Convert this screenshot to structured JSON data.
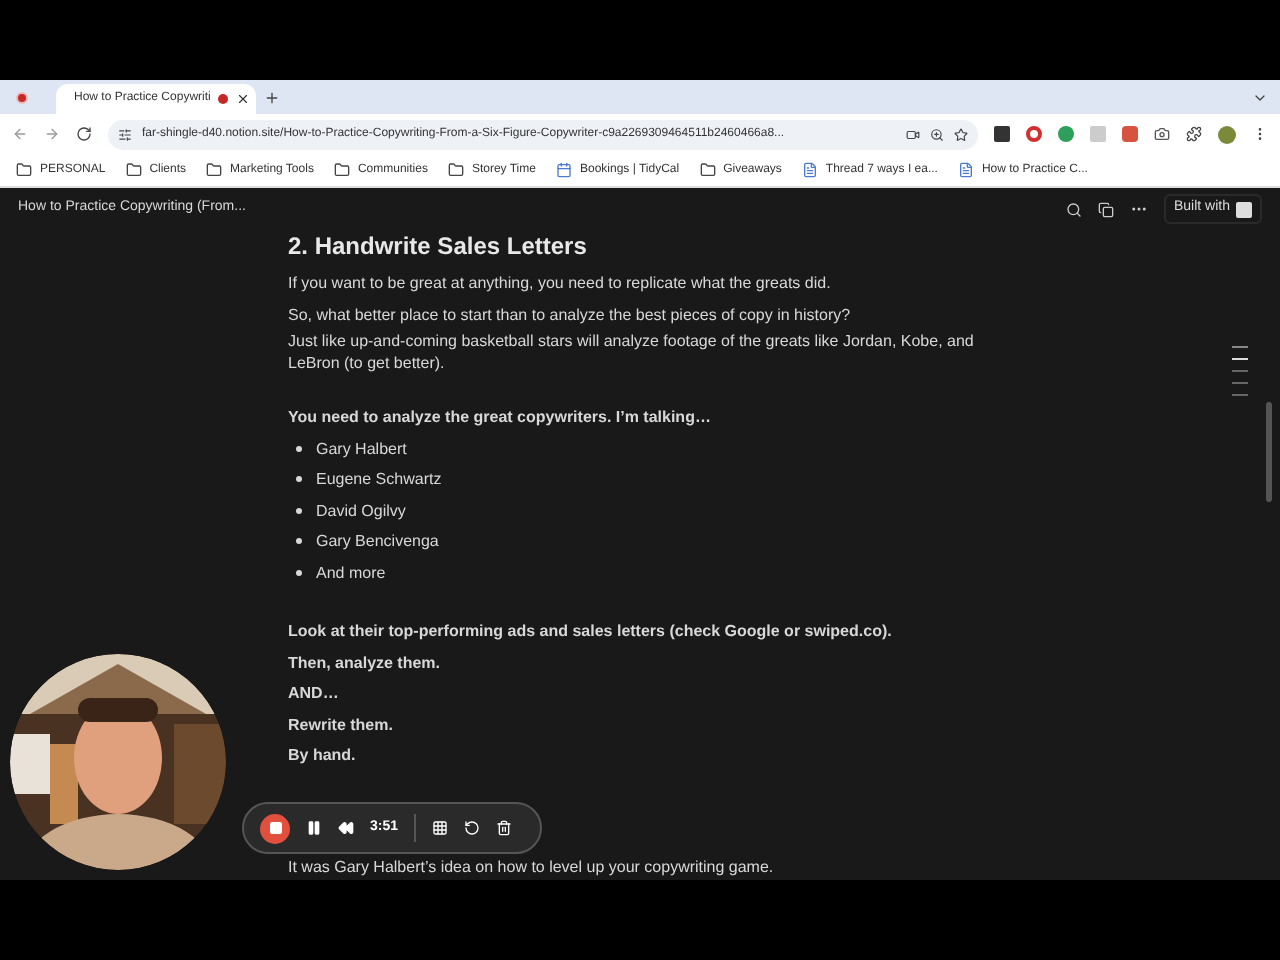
{
  "browser": {
    "tabs": [
      {
        "title": "How to Practice Copywriti",
        "selected": true,
        "recording": true
      }
    ],
    "url": "far-shingle-d40.notion.site/How-to-Practice-Copywriting-From-a-Six-Figure-Copywriter-c9a2269309464511b2460466a8...",
    "bookmarks": [
      {
        "kind": "folder",
        "label": "PERSONAL"
      },
      {
        "kind": "folder",
        "label": "Clients"
      },
      {
        "kind": "folder",
        "label": "Marketing Tools"
      },
      {
        "kind": "folder",
        "label": "Communities"
      },
      {
        "kind": "folder",
        "label": "Storey Time"
      },
      {
        "kind": "page",
        "label": "Bookings | TidyCal"
      },
      {
        "kind": "folder",
        "label": "Giveaways"
      },
      {
        "kind": "doc",
        "label": "Thread 7 ways I ea..."
      },
      {
        "kind": "doc",
        "label": "How to Practice C..."
      }
    ]
  },
  "page": {
    "title": "How to Practice Copywriting (From...",
    "built_with": "Built with",
    "sections": [
      {
        "blocks": [
          {
            "kind": "heading",
            "text": "2. Handwrite Sales Letters",
            "bold": true
          },
          {
            "kind": "text",
            "text": "If you want to be great at anything, you need to replicate what the greats did.",
            "bold": false
          },
          {
            "kind": "text",
            "text": "So, what better place to start than to analyze the best pieces of copy in history?",
            "bold": false
          },
          {
            "kind": "text",
            "text": "Just like up-and-coming basketball stars will analyze footage of the greats like Jordan, Kobe, and LeBron (to get better).",
            "bold": false
          }
        ]
      },
      {
        "blocks": [
          {
            "kind": "text",
            "text": "You need to analyze the great copywriters. I’m talking…",
            "bold": true
          },
          {
            "kind": "bullet",
            "text": "Gary Halbert",
            "bold": false
          },
          {
            "kind": "bullet",
            "text": "Eugene Schwartz",
            "bold": false
          },
          {
            "kind": "bullet",
            "text": "David Ogilvy",
            "bold": false
          },
          {
            "kind": "bullet",
            "text": "Gary Bencivenga",
            "bold": false
          },
          {
            "kind": "bullet",
            "text": "And more",
            "bold": false
          }
        ]
      },
      {
        "blocks": [
          {
            "kind": "text",
            "text": "Look at their top-performing ads and sales letters (check Google or swiped.co).",
            "bold": true
          },
          {
            "kind": "text",
            "text": "Then, analyze them.",
            "bold": true
          },
          {
            "kind": "text",
            "text": "AND…",
            "bold": true
          },
          {
            "kind": "text",
            "text": "Rewrite them.",
            "bold": true
          },
          {
            "kind": "text",
            "text": "By hand.",
            "bold": true
          },
          {
            "kind": "spacer"
          },
          {
            "kind": "text",
            "text": "It was Gary Halbert’s idea on how to level up your copywriting game.",
            "bold": false
          }
        ]
      }
    ]
  },
  "recorder": {
    "time": "3:51"
  }
}
